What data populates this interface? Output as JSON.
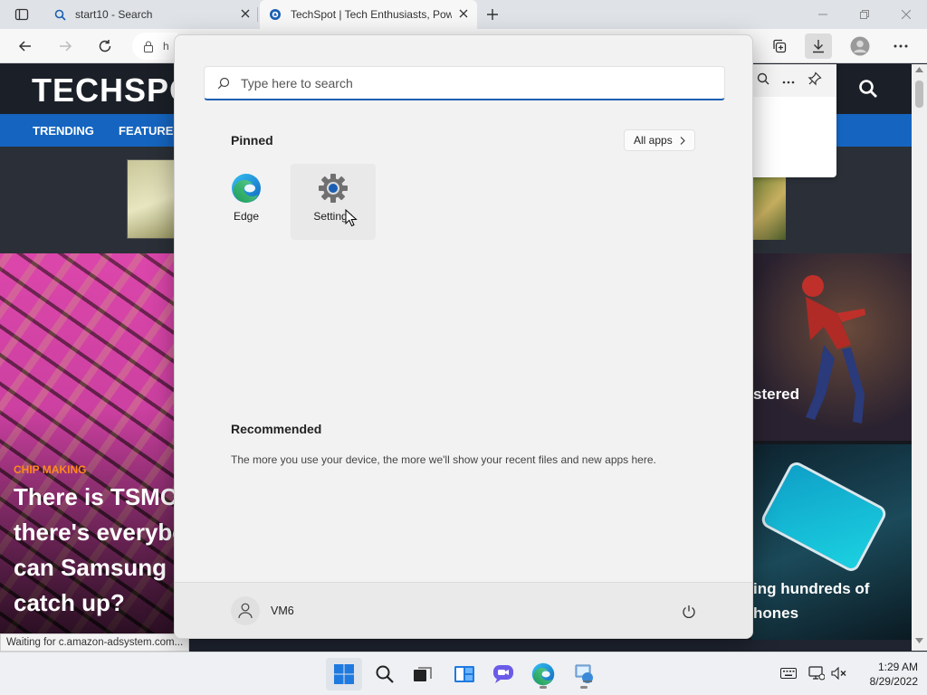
{
  "browser": {
    "tabs": [
      {
        "title": "start10 - Search",
        "icon": "search-icon"
      },
      {
        "title": "TechSpot | Tech Enthusiasts, Pow",
        "icon": "techspot-icon"
      }
    ],
    "address_partial": "h"
  },
  "page": {
    "logo": "TECHSPO",
    "nav": [
      "TRENDING",
      "FEATURES"
    ],
    "hero_kicker": "CHIP MAKING",
    "hero_title_lines": [
      "There is TSMC",
      "there's everybo",
      "can Samsung c",
      "catch up?"
    ],
    "right_top_title": "stered",
    "right_bottom_title_lines": [
      "ing hundreds of",
      "hones"
    ],
    "status_text": "Waiting for c.amazon-adsystem.com..."
  },
  "start_menu": {
    "search_placeholder": "Type here to search",
    "pinned_title": "Pinned",
    "all_apps_label": "All apps",
    "pinned": [
      {
        "label": "Edge",
        "icon": "edge-icon"
      },
      {
        "label": "Settings",
        "icon": "settings-gear-icon"
      }
    ],
    "recommended_title": "Recommended",
    "recommended_text": "The more you use your device, the more we'll show your recent files and new apps here.",
    "user_name": "VM6"
  },
  "taskbar": {
    "time": "1:29 AM",
    "date": "8/29/2022"
  },
  "colors": {
    "accent": "#1a5fb4",
    "nav_blue": "#1565c0",
    "kicker_orange": "#ff8a1c"
  }
}
